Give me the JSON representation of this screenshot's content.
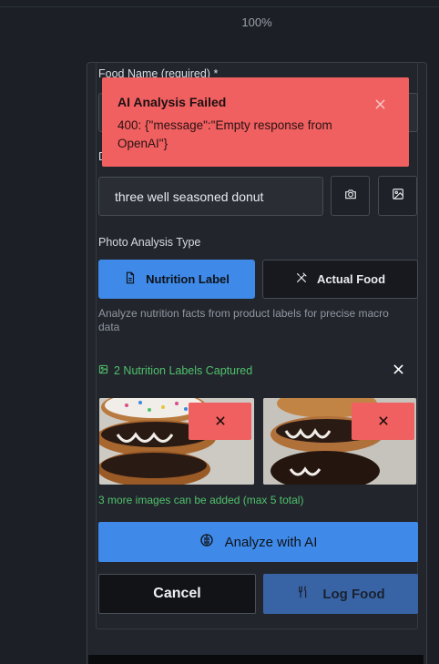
{
  "zoom": {
    "level": "100%"
  },
  "form": {
    "food_name_label": "Food Name (required) *",
    "description_value": "three well seasoned donut",
    "photo_type_label": "Photo Analysis Type",
    "nutrition_label_btn": "Nutrition Label",
    "actual_food_btn": "Actual Food",
    "help_text": "Analyze nutrition facts from product labels for precise macro data",
    "captured_text": "2 Nutrition Labels Captured",
    "more_images_text": "3 more images can be added (max 5 total)",
    "analyze_btn": "Analyze with AI",
    "cancel_btn": "Cancel",
    "log_food_btn": "Log Food"
  },
  "toast": {
    "title": "AI Analysis Failed",
    "message": "400: {\"message\":\"Empty response from OpenAI\"}"
  },
  "colors": {
    "accent": "#3f8ae8",
    "error": "#f06060",
    "success": "#4fc26b"
  }
}
